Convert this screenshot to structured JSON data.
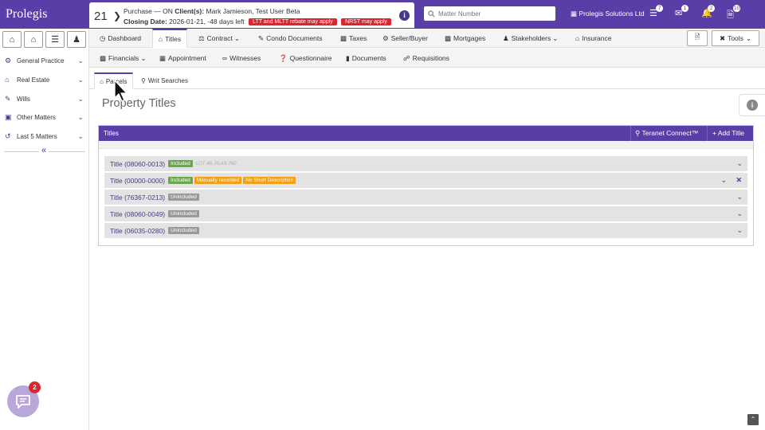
{
  "app": {
    "logo": "Prolegis"
  },
  "matter": {
    "number": "21",
    "type_line": "Purchase — ON",
    "clients_label": "Client(s):",
    "clients": "Mark Jamieson, Test User Beta",
    "closing_label": "Closing Date:",
    "closing": "2026-01-21, -48 days left",
    "badges": [
      "LTT and MLTT rebate may apply",
      "NRST may apply"
    ]
  },
  "search": {
    "placeholder": "Matter Number"
  },
  "header": {
    "firm": "Prolegis Solutions Ltd",
    "counts": {
      "tasks": "7",
      "mail": "1",
      "alerts": "2",
      "docs": "10"
    }
  },
  "sidebar": {
    "items": [
      {
        "label": "General Practice",
        "icon": "gear-icon"
      },
      {
        "label": "Real Estate",
        "icon": "home-icon"
      },
      {
        "label": "Wills",
        "icon": "scroll-icon"
      },
      {
        "label": "Other Matters",
        "icon": "briefcase-icon"
      },
      {
        "label": "Last 5 Matters",
        "icon": "history-icon"
      }
    ],
    "chat_count": "2"
  },
  "nav": {
    "row1": [
      {
        "label": "Dashboard",
        "icon": "dashboard-icon"
      },
      {
        "label": "Titles",
        "icon": "bank-icon",
        "active": true
      },
      {
        "label": "Contract",
        "icon": "scale-icon"
      },
      {
        "label": "Condo Documents",
        "icon": "edit-icon"
      },
      {
        "label": "Taxes",
        "icon": "money-icon"
      },
      {
        "label": "Seller/Buyer",
        "icon": "users-gear-icon"
      },
      {
        "label": "Mortgages",
        "icon": "money-check-icon"
      },
      {
        "label": "Stakeholders",
        "icon": "users-icon"
      },
      {
        "label": "Insurance",
        "icon": "home-icon"
      }
    ],
    "row2": [
      {
        "label": "Financials",
        "icon": "money-icon"
      },
      {
        "label": "Appointment",
        "icon": "calendar-icon"
      },
      {
        "label": "Witnesses",
        "icon": "glasses-icon"
      },
      {
        "label": "Questionnaire",
        "icon": "question-icon"
      },
      {
        "label": "Documents",
        "icon": "file-icon"
      },
      {
        "label": "Requisitions",
        "icon": "handshake-icon"
      }
    ],
    "tools_label": "Tools"
  },
  "subtabs": [
    {
      "label": "Parcels",
      "active": true
    },
    {
      "label": "Writ Searches"
    }
  ],
  "page": {
    "title": "Property Titles"
  },
  "panel": {
    "header": "Titles",
    "teranet_label": "Teranet Connect™",
    "add_label": "+ Add Title",
    "rows": [
      {
        "name": "Title (08060-0013)",
        "tags": [
          {
            "text": "Included",
            "color": "green"
          }
        ],
        "note": "LOT 48, PLAN 760"
      },
      {
        "name": "Title (00000-0000)",
        "tags": [
          {
            "text": "Included",
            "color": "green"
          },
          {
            "text": "Manually recorded",
            "color": "orange"
          },
          {
            "text": "No Short Description",
            "color": "orange"
          }
        ],
        "note": ""
      },
      {
        "name": "Title (76367-0213)",
        "tags": [
          {
            "text": "Unincluded",
            "color": "gray"
          }
        ],
        "note": ""
      },
      {
        "name": "Title (08060-0049)",
        "tags": [
          {
            "text": "Unincluded",
            "color": "gray"
          }
        ],
        "note": ""
      },
      {
        "name": "Title (06035-0280)",
        "tags": [
          {
            "text": "Unincluded",
            "color": "gray"
          }
        ],
        "note": ""
      }
    ]
  },
  "colors": {
    "brand": "#5a3ea8",
    "included": "#6aa84f",
    "warning": "#f1a118",
    "alert": "#d9262f",
    "unincluded": "#999999"
  }
}
